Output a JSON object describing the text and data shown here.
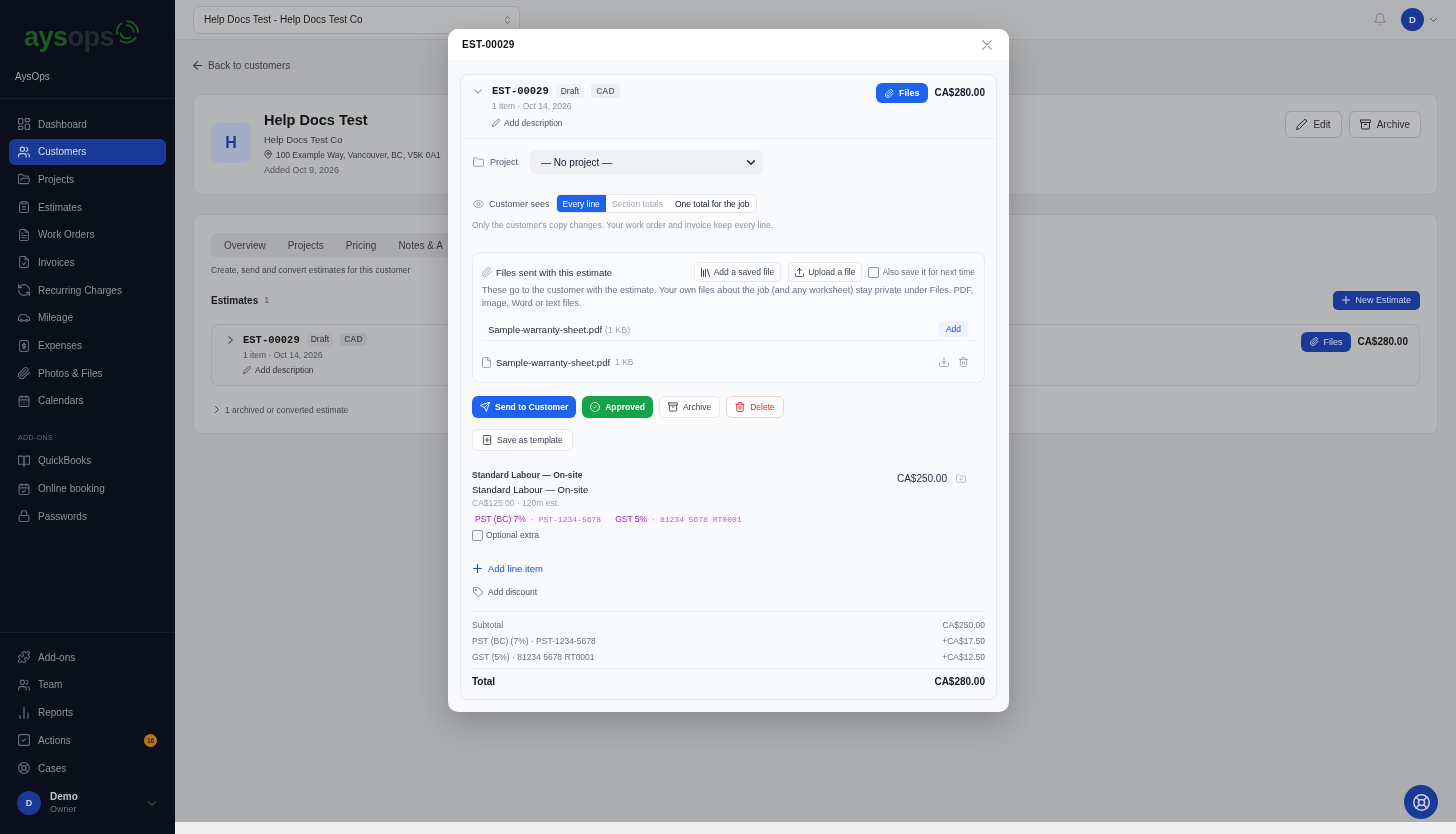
{
  "sidebar": {
    "logo": {
      "lead": "ays",
      "tail": "ops"
    },
    "workspace": "AysOps",
    "nav_items": [
      {
        "label": "Dashboard",
        "selected": false
      },
      {
        "label": "Customers",
        "selected": true
      },
      {
        "label": "Projects",
        "selected": false
      },
      {
        "label": "Estimates",
        "selected": false
      },
      {
        "label": "Work Orders",
        "selected": false
      },
      {
        "label": "Invoices",
        "selected": false
      },
      {
        "label": "Recurring Charges",
        "selected": false
      },
      {
        "label": "Mileage",
        "selected": false
      },
      {
        "label": "Expenses",
        "selected": false
      },
      {
        "label": "Photos & Files",
        "selected": false
      },
      {
        "label": "Calendars",
        "selected": false
      }
    ],
    "addons": {
      "heading": "ADD-ONS",
      "items": [
        {
          "label": "QuickBooks",
          "selected": false
        },
        {
          "label": "Online booking",
          "selected": false
        },
        {
          "label": "Passwords",
          "selected": false
        }
      ]
    },
    "footer_items": [
      {
        "label": "Add-ons",
        "selected": false
      },
      {
        "label": "Team",
        "selected": false
      },
      {
        "label": "Reports",
        "selected": false
      },
      {
        "label": "Actions",
        "selected": false,
        "badge": "16"
      },
      {
        "label": "Cases",
        "selected": false
      }
    ],
    "user": {
      "initial": "D",
      "name": "Demo",
      "role": "Owner"
    }
  },
  "top_bar": {
    "customer_select": {
      "value": "Help Docs Test - Help Docs Test Co"
    },
    "account": {
      "initial": "D"
    }
  },
  "customer_page": {
    "back_link": "Back to customers",
    "customer": {
      "initial": "H",
      "name": "Help Docs Test",
      "company": "Help Docs Test Co",
      "address": "100 Example Way, Vancouver, BC, V5K 0A1",
      "added": "Added Oct 9, 2026",
      "buttons": [
        "Edit",
        "Archive"
      ]
    },
    "tabs": [
      {
        "label": "Overview",
        "selected": false
      },
      {
        "label": "Projects",
        "selected": false
      },
      {
        "label": "Pricing",
        "selected": false
      },
      {
        "label": "Notes & A",
        "selected": false
      }
    ],
    "section_description": "Create, send and convert estimates for this customer",
    "estimates_title": "Estimates",
    "estimates_count": "1",
    "new_estimate_button": "New Estimate",
    "estimates": [
      {
        "number": "EST-00029",
        "status": "Draft",
        "currency": "CAD",
        "meta": "1 item · Oct 14, 2026",
        "add_description": "Add description",
        "files_button": "Files",
        "total": "CA$280.00",
        "expanded": false
      }
    ],
    "archived_link": "1 archived or converted estimate"
  },
  "estimate_dialog": {
    "title": "EST-00029",
    "estimate": {
      "number": "EST-00029",
      "status": "Draft",
      "currency": "CAD",
      "meta": "1 item · Oct 14, 2026",
      "add_description": "Add description",
      "files_button": "Files",
      "total": "CA$280.00",
      "expanded": true
    },
    "project": {
      "label": "Project",
      "value": "— No project —"
    },
    "customer_sees": {
      "label": "Customer sees",
      "options": [
        {
          "label": "Every line",
          "selected": true,
          "disabled": false
        },
        {
          "label": "Section totals",
          "selected": false,
          "disabled": true
        },
        {
          "label": "One total for the job",
          "selected": false,
          "disabled": false
        }
      ],
      "hint": "Only the customer's copy changes. Your work order and invoice keep every line."
    },
    "files": {
      "title": "Files sent with this estimate",
      "add_saved_button": "Add a saved file",
      "upload_button": "Upload a file",
      "save_for_next_time": {
        "label": "Also save it for next time",
        "checked": false
      },
      "description": "These go to the customer with the estimate. Your own files about the job (and any worksheet) stay private under Files. PDF, image, Word or text files.",
      "suggestions": [
        {
          "name": "Sample-warranty-sheet.pdf",
          "size": "(1 KB)",
          "action": "Add"
        }
      ],
      "attached": [
        {
          "name": "Sample-warranty-sheet.pdf",
          "size": "1 KB"
        }
      ]
    },
    "actions": [
      {
        "label": "Send to Customer",
        "kind": "primary"
      },
      {
        "label": "Approved",
        "kind": "success"
      },
      {
        "label": "Archive",
        "kind": "neutral"
      },
      {
        "label": "Delete",
        "kind": "danger"
      }
    ],
    "save_template_button": "Save as template",
    "line_items": [
      {
        "title": "Standard Labour — On-site",
        "description": "Standard Labour — On-site",
        "rate": "CA$125.00 · 120m est.",
        "taxes": [
          {
            "name": "PST (BC) 7%",
            "separator": "·",
            "number": "PST-1234-5678"
          },
          {
            "name": "GST 5%",
            "separator": "·",
            "number": "81234 5678 RT0001"
          }
        ],
        "optional": {
          "label": "Optional extra",
          "checked": false
        },
        "amount": "CA$250.00"
      }
    ],
    "add_line_item": "Add line item",
    "add_discount": "Add discount",
    "totals": [
      {
        "label": "Subtotal",
        "value": "CA$250.00",
        "kind": "line"
      },
      {
        "label": "PST (BC) (7%) · PST-1234-5678",
        "value": "+CA$17.50",
        "kind": "line"
      },
      {
        "label": "GST (5%) · 81234 5678 RT0001",
        "value": "+CA$12.50",
        "kind": "line"
      },
      {
        "label": "Total",
        "value": "CA$280.00",
        "kind": "total"
      }
    ]
  }
}
